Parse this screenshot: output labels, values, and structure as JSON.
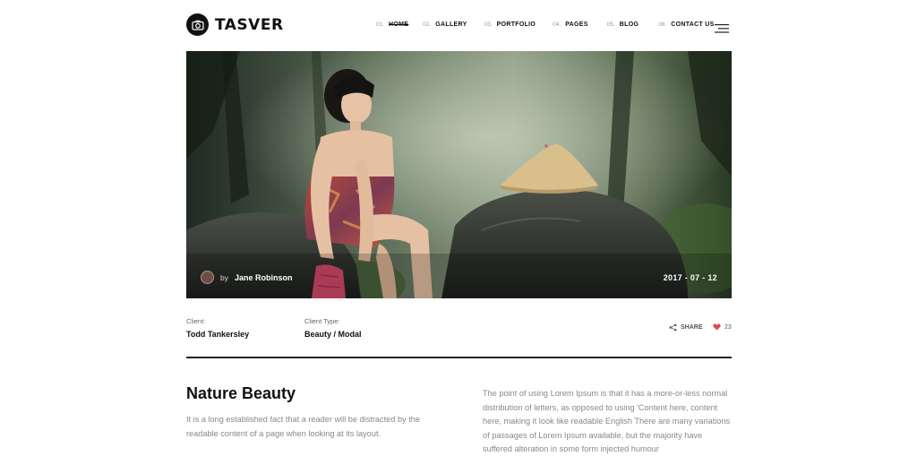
{
  "brand": {
    "name": "TASVER"
  },
  "nav": {
    "items": [
      {
        "num": "01.",
        "label": "HOME",
        "active": true
      },
      {
        "num": "02.",
        "label": "GALLERY"
      },
      {
        "num": "03.",
        "label": "PORTFOLIO"
      },
      {
        "num": "04.",
        "label": "PAGES"
      },
      {
        "num": "05.",
        "label": "BLOG"
      },
      {
        "num": "06.",
        "label": "CONTACT US"
      }
    ],
    "menu_icon": "hamburger-icon"
  },
  "hero": {
    "author_prefix": "by",
    "author_name": "Jane Robinson",
    "date": "2017 - 07 - 12"
  },
  "meta": {
    "client_label": "Client:",
    "client_value": "Todd Tankersley",
    "type_label": "Client Type:",
    "type_value": "Beauty / Modal",
    "share_label": "SHARE",
    "likes_count": "23"
  },
  "content": {
    "title": "Nature Beauty",
    "left_text": "It is a long established fact that a reader will be distracted by the readable content of a page when looking at its layout.",
    "right_text": "The point of using Lorem Ipsum is that it has a more-or-less normal distribution of letters, as opposed to using 'Content here, content here, making it look like readable English There are many variations of passages of Lorem Ipsum available, but the majority have suffered alteration in some form injected humour"
  },
  "colors": {
    "accent": "#e0474c",
    "text_dark": "#111111",
    "text_muted": "#888888"
  }
}
